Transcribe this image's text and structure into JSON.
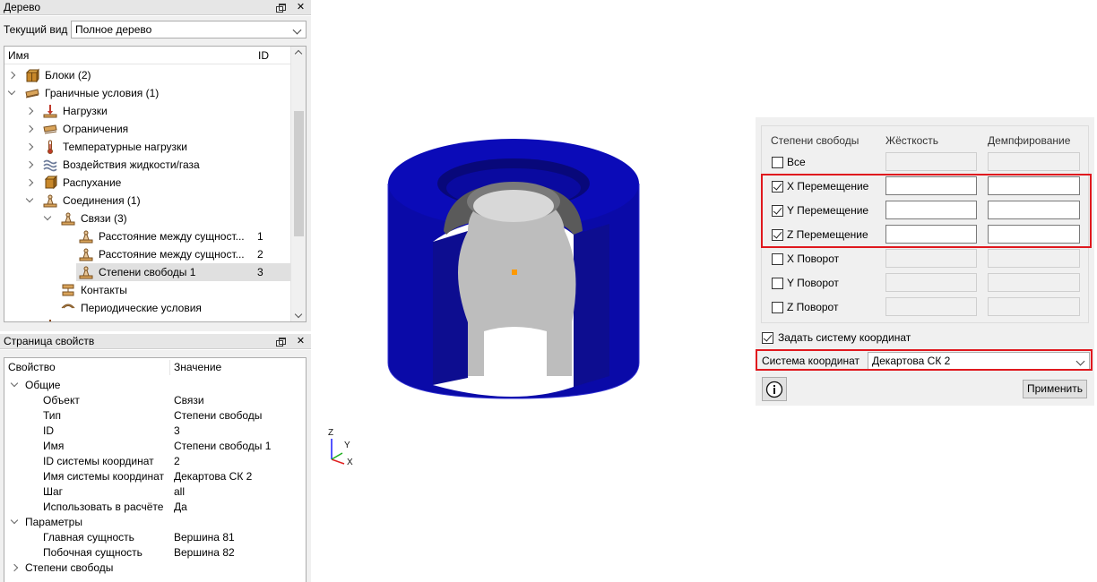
{
  "tree_panel": {
    "title": "Дерево",
    "view_label": "Текущий вид",
    "view_value": "Полное дерево",
    "col_name": "Имя",
    "col_id": "ID",
    "rows": [
      {
        "label": "Блоки (2)",
        "id": "",
        "icon": "blocks-icon"
      },
      {
        "label": "Граничные условия (1)",
        "id": "",
        "icon": "boundary-conditions-icon"
      },
      {
        "label": "Нагрузки",
        "id": "",
        "icon": "loads-icon"
      },
      {
        "label": "Ограничения",
        "id": "",
        "icon": "constraints-icon"
      },
      {
        "label": "Температурные нагрузки",
        "id": "",
        "icon": "thermometer-icon"
      },
      {
        "label": "Воздействия жидкости/газа",
        "id": "",
        "icon": "fluid-icon"
      },
      {
        "label": "Распухание",
        "id": "",
        "icon": "swelling-icon"
      },
      {
        "label": "Соединения (1)",
        "id": "",
        "icon": "connections-icon"
      },
      {
        "label": "Связи (3)",
        "id": "",
        "icon": "links-icon"
      },
      {
        "label": "Расстояние между сущност...",
        "id": "1",
        "icon": "link-item-icon"
      },
      {
        "label": "Расстояние между сущност...",
        "id": "2",
        "icon": "link-item-icon"
      },
      {
        "label": "Степени свободы 1",
        "id": "3",
        "icon": "link-item-icon"
      },
      {
        "label": "Контакты",
        "id": "",
        "icon": "contacts-icon"
      },
      {
        "label": "Периодические условия",
        "id": "",
        "icon": "periodic-icon"
      }
    ]
  },
  "props_panel": {
    "title": "Страница свойств",
    "col_prop": "Свойство",
    "col_value": "Значение",
    "rows": [
      {
        "key": "Общие",
        "value": ""
      },
      {
        "key": "Объект",
        "value": "Связи"
      },
      {
        "key": "Тип",
        "value": "Степени свободы"
      },
      {
        "key": "ID",
        "value": "3"
      },
      {
        "key": "Имя",
        "value": "Степени свободы 1"
      },
      {
        "key": "ID системы координат",
        "value": "2"
      },
      {
        "key": "Имя системы координат",
        "value": "Декартова СК 2"
      },
      {
        "key": "Шаг",
        "value": "all"
      },
      {
        "key": "Использовать в расчёте",
        "value": "Да"
      },
      {
        "key": "Параметры",
        "value": ""
      },
      {
        "key": "Главная сущность",
        "value": "Вершина 81"
      },
      {
        "key": "Побочная сущность",
        "value": "Вершина 82"
      },
      {
        "key": "Степени свободы",
        "value": ""
      }
    ]
  },
  "viewport": {
    "axis_z": "Z",
    "axis_y": "Y",
    "axis_x": "X",
    "model_color": "#0a0aa8",
    "inner_color": "#bdbdbd"
  },
  "dof_panel": {
    "col_dof": "Степени свободы",
    "col_stiffness": "Жёсткость",
    "col_damping": "Демпфирование",
    "rows": [
      {
        "label": "Все",
        "checked": false
      },
      {
        "label": "X Перемещение",
        "checked": true
      },
      {
        "label": "Y Перемещение",
        "checked": true
      },
      {
        "label": "Z Перемещение",
        "checked": true
      },
      {
        "label": "X Поворот",
        "checked": false
      },
      {
        "label": "Y Поворот",
        "checked": false
      },
      {
        "label": "Z Поворот",
        "checked": false
      }
    ],
    "set_cs_label": "Задать систему координат",
    "set_cs_checked": true,
    "cs_label": "Система координат",
    "cs_value": "Декартова СК 2",
    "apply_label": "Применить",
    "highlight_color": "#e0181e"
  }
}
